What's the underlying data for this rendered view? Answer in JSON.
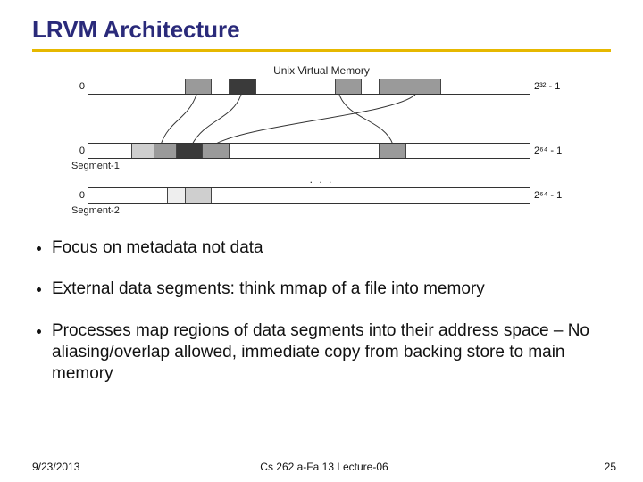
{
  "title": "LRVM Architecture",
  "diagram": {
    "top": {
      "header": "Unix Virtual Memory",
      "left": "0",
      "right": "2³² - 1",
      "segs": [
        {
          "w": "22%",
          "bg": "#fff"
        },
        {
          "w": "6%",
          "bg": "#9a9a9a"
        },
        {
          "w": "4%",
          "bg": "#fff"
        },
        {
          "w": "6%",
          "bg": "#3a3a3a"
        },
        {
          "w": "18%",
          "bg": "#fff"
        },
        {
          "w": "6%",
          "bg": "#9a9a9a"
        },
        {
          "w": "4%",
          "bg": "#fff"
        },
        {
          "w": "14%",
          "bg": "#9a9a9a"
        },
        {
          "w": "20%",
          "bg": "#fff"
        }
      ]
    },
    "mid": {
      "label": "Segment-1",
      "left": "0",
      "right": "2⁶⁴ - 1",
      "segs": [
        {
          "w": "10%",
          "bg": "#fff"
        },
        {
          "w": "5%",
          "bg": "#cfcfcf"
        },
        {
          "w": "5%",
          "bg": "#9a9a9a"
        },
        {
          "w": "6%",
          "bg": "#3a3a3a"
        },
        {
          "w": "6%",
          "bg": "#9a9a9a"
        },
        {
          "w": "34%",
          "bg": "#fff"
        },
        {
          "w": "6%",
          "bg": "#9a9a9a"
        },
        {
          "w": "28%",
          "bg": "#fff"
        }
      ],
      "dots": ". . ."
    },
    "bot": {
      "label": "Segment-2",
      "left": "0",
      "right": "2⁶⁴ - 1",
      "segs": [
        {
          "w": "18%",
          "bg": "#fff"
        },
        {
          "w": "4%",
          "bg": "#eeeeee"
        },
        {
          "w": "6%",
          "bg": "#cfcfcf"
        },
        {
          "w": "72%",
          "bg": "#fff"
        }
      ]
    }
  },
  "bullets": [
    "Focus on metadata not data",
    "External data segments: think mmap of a file into memory",
    "Processes map regions of data segments into their address space – No aliasing/overlap allowed, immediate copy from backing store to main memory"
  ],
  "footer": {
    "date": "9/23/2013",
    "center": "Cs 262 a-Fa 13 Lecture-06",
    "page": "25"
  }
}
